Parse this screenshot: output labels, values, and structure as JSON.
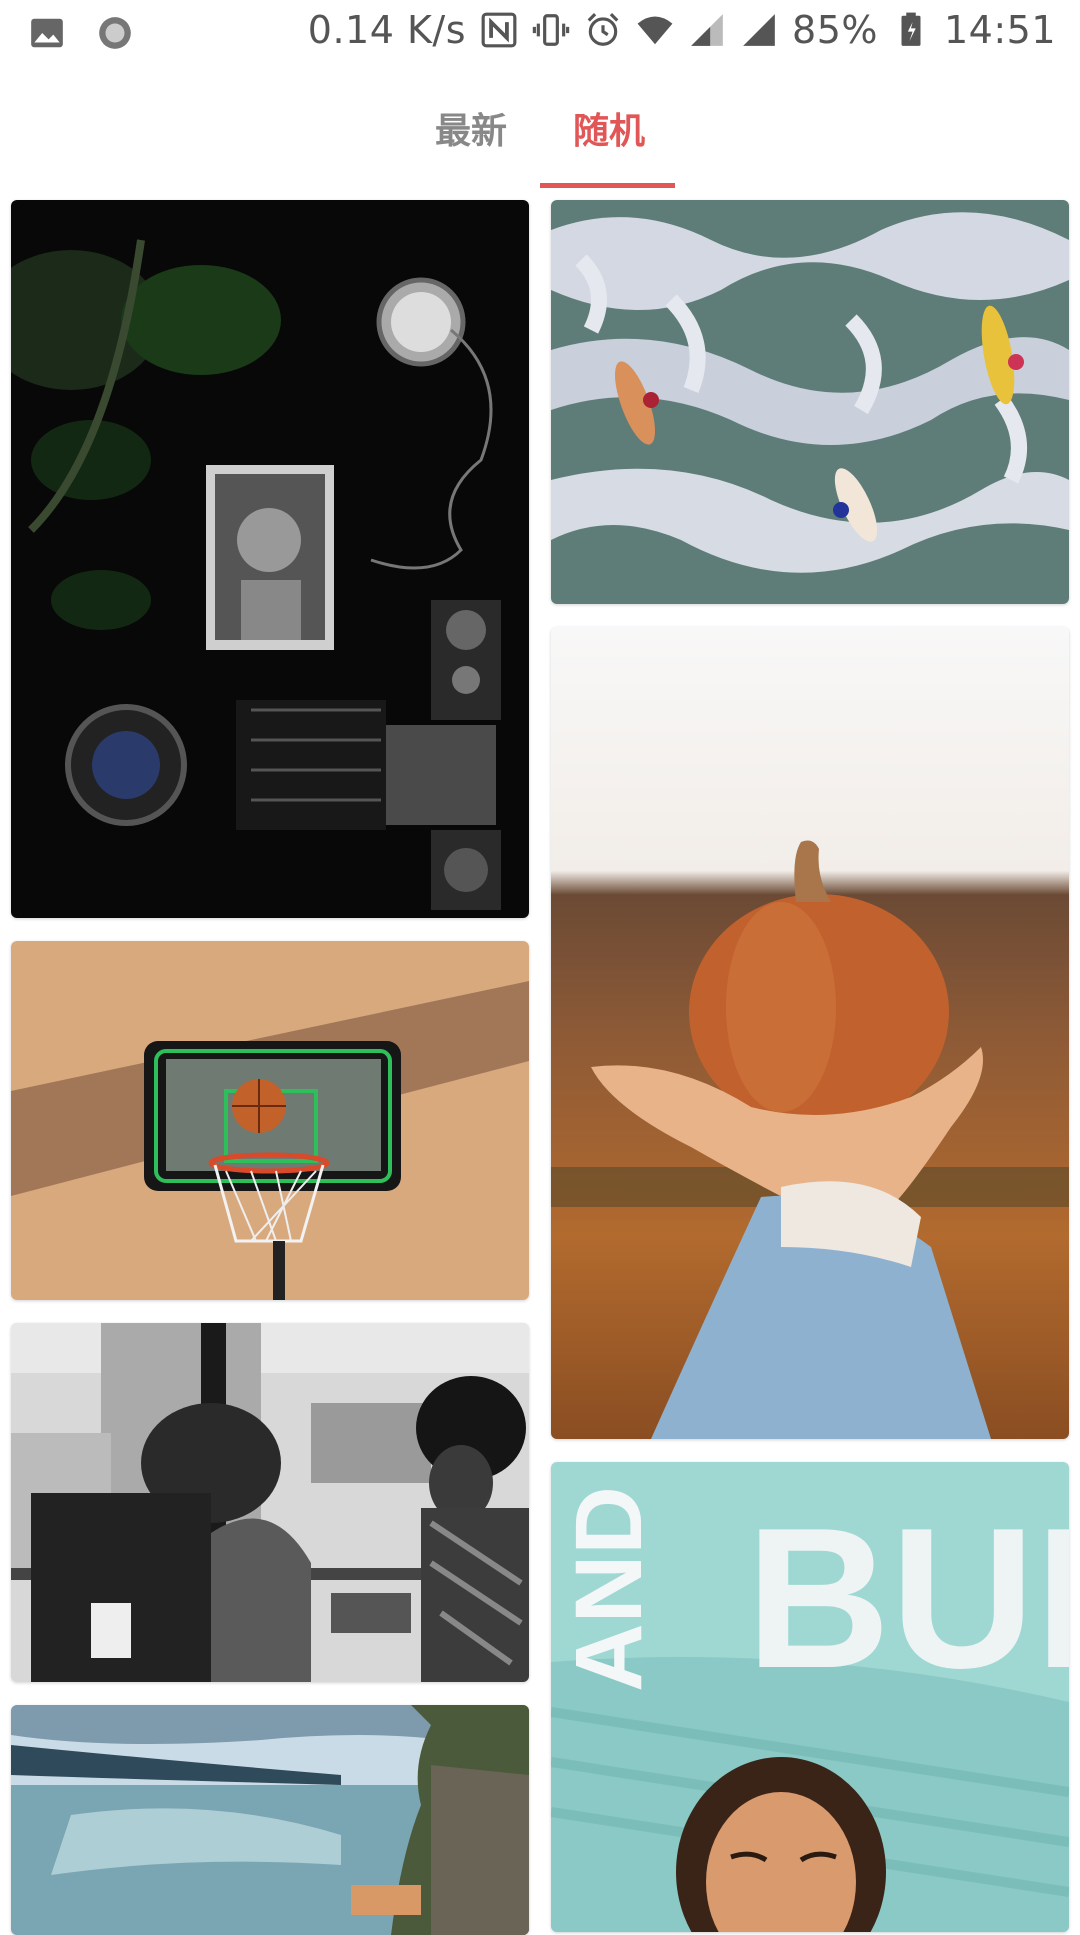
{
  "status_bar": {
    "net_speed": "0.14 K/s",
    "battery": "85%",
    "time": "14:51",
    "icons": [
      "gallery-icon",
      "record-icon",
      "nfc-icon",
      "vibrate-icon",
      "alarm-icon",
      "wifi-icon",
      "signal-icon",
      "signal-icon-2",
      "battery-icon"
    ]
  },
  "tabs": [
    {
      "label": "最新",
      "active": false
    },
    {
      "label": "随机",
      "active": true
    }
  ],
  "colors": {
    "accent": "#e15656",
    "tab_inactive": "#888888"
  },
  "photos": [
    {
      "name": "camera-flatlay-photo"
    },
    {
      "name": "surfers-ocean-photo"
    },
    {
      "name": "pumpkin-hand-photo"
    },
    {
      "name": "basketball-hoop-photo"
    },
    {
      "name": "bus-passengers-photo"
    },
    {
      "name": "woman-mural-photo"
    },
    {
      "name": "coastal-cliff-photo"
    }
  ]
}
